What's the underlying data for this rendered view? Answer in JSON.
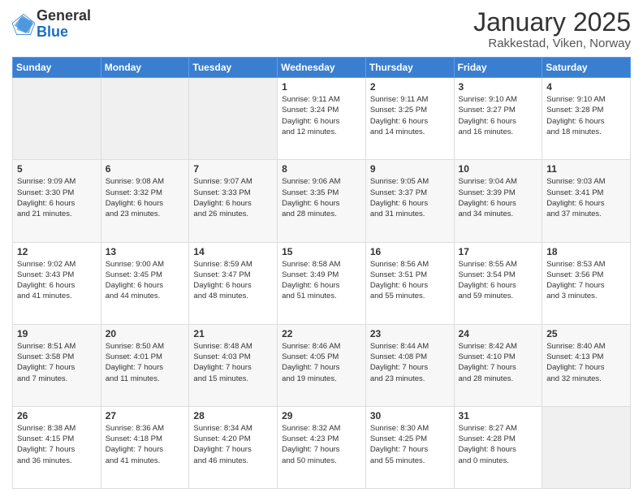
{
  "header": {
    "logo": {
      "general": "General",
      "blue": "Blue"
    },
    "title": "January 2025",
    "location": "Rakkestad, Viken, Norway"
  },
  "weekdays": [
    "Sunday",
    "Monday",
    "Tuesday",
    "Wednesday",
    "Thursday",
    "Friday",
    "Saturday"
  ],
  "weeks": [
    [
      {
        "day": "",
        "info": ""
      },
      {
        "day": "",
        "info": ""
      },
      {
        "day": "",
        "info": ""
      },
      {
        "day": "1",
        "info": "Sunrise: 9:11 AM\nSunset: 3:24 PM\nDaylight: 6 hours\nand 12 minutes."
      },
      {
        "day": "2",
        "info": "Sunrise: 9:11 AM\nSunset: 3:25 PM\nDaylight: 6 hours\nand 14 minutes."
      },
      {
        "day": "3",
        "info": "Sunrise: 9:10 AM\nSunset: 3:27 PM\nDaylight: 6 hours\nand 16 minutes."
      },
      {
        "day": "4",
        "info": "Sunrise: 9:10 AM\nSunset: 3:28 PM\nDaylight: 6 hours\nand 18 minutes."
      }
    ],
    [
      {
        "day": "5",
        "info": "Sunrise: 9:09 AM\nSunset: 3:30 PM\nDaylight: 6 hours\nand 21 minutes."
      },
      {
        "day": "6",
        "info": "Sunrise: 9:08 AM\nSunset: 3:32 PM\nDaylight: 6 hours\nand 23 minutes."
      },
      {
        "day": "7",
        "info": "Sunrise: 9:07 AM\nSunset: 3:33 PM\nDaylight: 6 hours\nand 26 minutes."
      },
      {
        "day": "8",
        "info": "Sunrise: 9:06 AM\nSunset: 3:35 PM\nDaylight: 6 hours\nand 28 minutes."
      },
      {
        "day": "9",
        "info": "Sunrise: 9:05 AM\nSunset: 3:37 PM\nDaylight: 6 hours\nand 31 minutes."
      },
      {
        "day": "10",
        "info": "Sunrise: 9:04 AM\nSunset: 3:39 PM\nDaylight: 6 hours\nand 34 minutes."
      },
      {
        "day": "11",
        "info": "Sunrise: 9:03 AM\nSunset: 3:41 PM\nDaylight: 6 hours\nand 37 minutes."
      }
    ],
    [
      {
        "day": "12",
        "info": "Sunrise: 9:02 AM\nSunset: 3:43 PM\nDaylight: 6 hours\nand 41 minutes."
      },
      {
        "day": "13",
        "info": "Sunrise: 9:00 AM\nSunset: 3:45 PM\nDaylight: 6 hours\nand 44 minutes."
      },
      {
        "day": "14",
        "info": "Sunrise: 8:59 AM\nSunset: 3:47 PM\nDaylight: 6 hours\nand 48 minutes."
      },
      {
        "day": "15",
        "info": "Sunrise: 8:58 AM\nSunset: 3:49 PM\nDaylight: 6 hours\nand 51 minutes."
      },
      {
        "day": "16",
        "info": "Sunrise: 8:56 AM\nSunset: 3:51 PM\nDaylight: 6 hours\nand 55 minutes."
      },
      {
        "day": "17",
        "info": "Sunrise: 8:55 AM\nSunset: 3:54 PM\nDaylight: 6 hours\nand 59 minutes."
      },
      {
        "day": "18",
        "info": "Sunrise: 8:53 AM\nSunset: 3:56 PM\nDaylight: 7 hours\nand 3 minutes."
      }
    ],
    [
      {
        "day": "19",
        "info": "Sunrise: 8:51 AM\nSunset: 3:58 PM\nDaylight: 7 hours\nand 7 minutes."
      },
      {
        "day": "20",
        "info": "Sunrise: 8:50 AM\nSunset: 4:01 PM\nDaylight: 7 hours\nand 11 minutes."
      },
      {
        "day": "21",
        "info": "Sunrise: 8:48 AM\nSunset: 4:03 PM\nDaylight: 7 hours\nand 15 minutes."
      },
      {
        "day": "22",
        "info": "Sunrise: 8:46 AM\nSunset: 4:05 PM\nDaylight: 7 hours\nand 19 minutes."
      },
      {
        "day": "23",
        "info": "Sunrise: 8:44 AM\nSunset: 4:08 PM\nDaylight: 7 hours\nand 23 minutes."
      },
      {
        "day": "24",
        "info": "Sunrise: 8:42 AM\nSunset: 4:10 PM\nDaylight: 7 hours\nand 28 minutes."
      },
      {
        "day": "25",
        "info": "Sunrise: 8:40 AM\nSunset: 4:13 PM\nDaylight: 7 hours\nand 32 minutes."
      }
    ],
    [
      {
        "day": "26",
        "info": "Sunrise: 8:38 AM\nSunset: 4:15 PM\nDaylight: 7 hours\nand 36 minutes."
      },
      {
        "day": "27",
        "info": "Sunrise: 8:36 AM\nSunset: 4:18 PM\nDaylight: 7 hours\nand 41 minutes."
      },
      {
        "day": "28",
        "info": "Sunrise: 8:34 AM\nSunset: 4:20 PM\nDaylight: 7 hours\nand 46 minutes."
      },
      {
        "day": "29",
        "info": "Sunrise: 8:32 AM\nSunset: 4:23 PM\nDaylight: 7 hours\nand 50 minutes."
      },
      {
        "day": "30",
        "info": "Sunrise: 8:30 AM\nSunset: 4:25 PM\nDaylight: 7 hours\nand 55 minutes."
      },
      {
        "day": "31",
        "info": "Sunrise: 8:27 AM\nSunset: 4:28 PM\nDaylight: 8 hours\nand 0 minutes."
      },
      {
        "day": "",
        "info": ""
      }
    ]
  ]
}
